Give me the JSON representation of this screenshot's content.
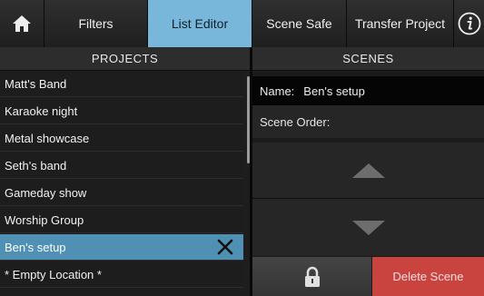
{
  "nav": {
    "home_icon": "home-icon",
    "filters": "Filters",
    "list_editor": "List Editor",
    "scene_safe": "Scene Safe",
    "transfer_project": "Transfer Project",
    "info_icon": "info-icon",
    "active_tab": "List Editor",
    "active_color": "#79b7da"
  },
  "projects": {
    "header": "PROJECTS",
    "items": [
      "Matt's Band",
      "Karaoke night",
      "Metal showcase",
      "Seth's band",
      "Gameday show",
      "Worship Group",
      "Ben's setup",
      "* Empty Location *"
    ],
    "selected": "Ben's setup",
    "selected_color": "#4f90b4",
    "clear_icon": "close-icon"
  },
  "scenes": {
    "header": "SCENES",
    "name_label": "Name:",
    "name_value": "Ben's setup",
    "order_label": "Scene Order:",
    "up_icon": "triangle-up-icon",
    "down_icon": "triangle-down-icon",
    "lock_icon": "lock-icon",
    "delete_label": "Delete Scene",
    "delete_color": "#c9433f"
  }
}
